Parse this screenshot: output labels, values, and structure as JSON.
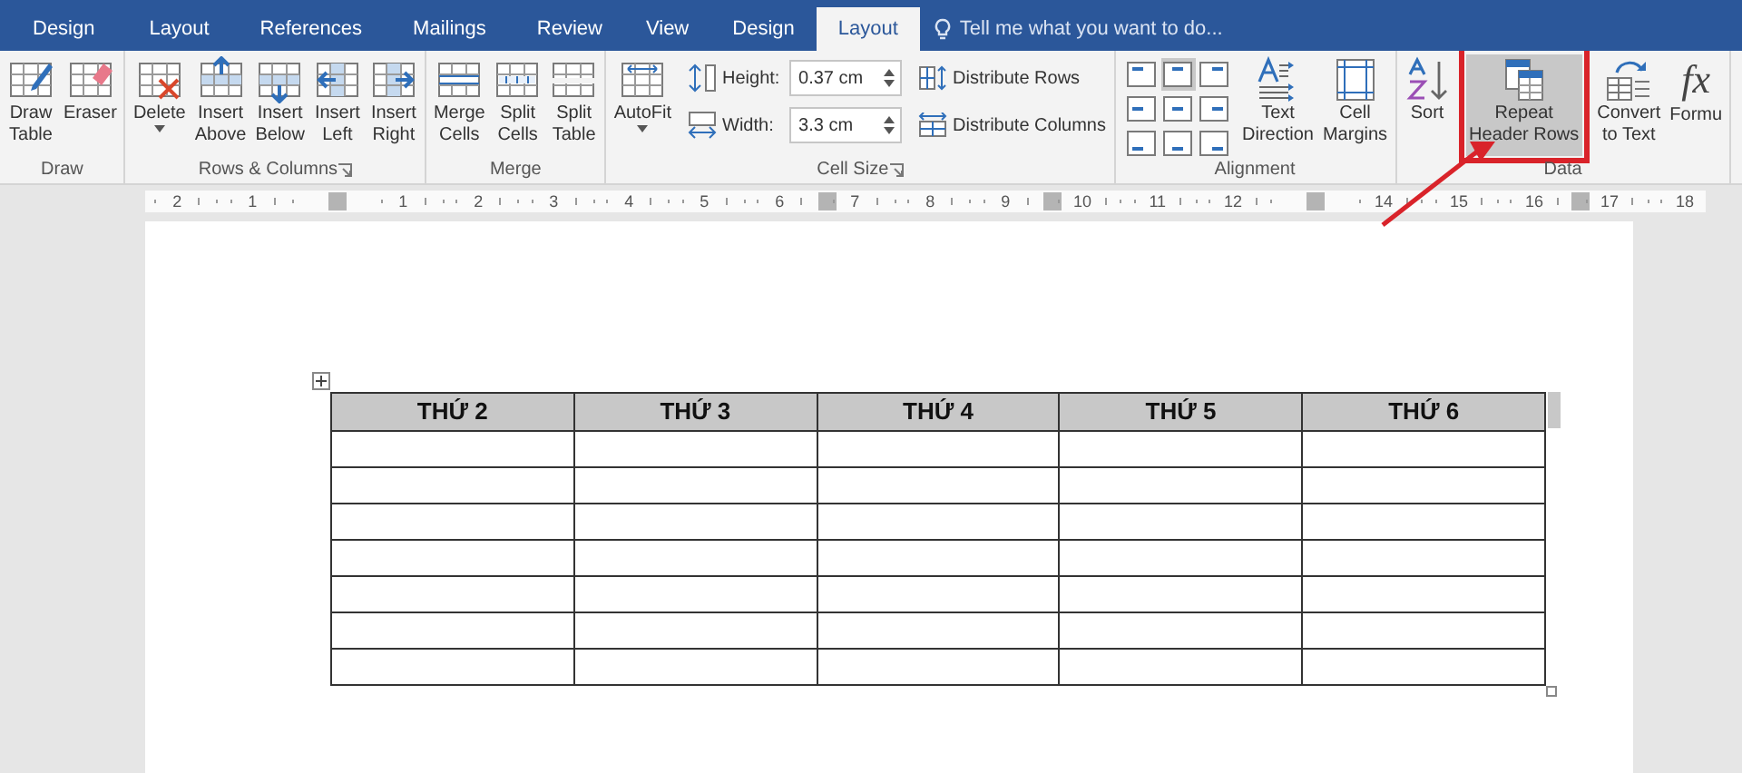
{
  "tabs": [
    {
      "label": "Design",
      "selected": false
    },
    {
      "label": "Layout",
      "selected": false
    },
    {
      "label": "References",
      "selected": false
    },
    {
      "label": "Mailings",
      "selected": false
    },
    {
      "label": "Review",
      "selected": false
    },
    {
      "label": "View",
      "selected": false
    },
    {
      "label": "Design",
      "selected": false
    },
    {
      "label": "Layout",
      "selected": true
    }
  ],
  "tell_me": {
    "placeholder": "Tell me what you want to do..."
  },
  "ribbon_groups": [
    {
      "label": "Draw",
      "launcher": false,
      "items": [
        {
          "kind": "large",
          "lines": [
            "Draw",
            "Table"
          ],
          "dropdown": false,
          "selected": false
        },
        {
          "kind": "large",
          "lines": [
            "Eraser"
          ],
          "dropdown": false,
          "selected": false
        }
      ]
    },
    {
      "label": "Rows & Columns",
      "launcher": true,
      "items": [
        {
          "kind": "large",
          "lines": [
            "Delete"
          ],
          "dropdown": true,
          "selected": false
        },
        {
          "kind": "large",
          "lines": [
            "Insert",
            "Above"
          ],
          "dropdown": false,
          "selected": false
        },
        {
          "kind": "large",
          "lines": [
            "Insert",
            "Below"
          ],
          "dropdown": false,
          "selected": false
        },
        {
          "kind": "large",
          "lines": [
            "Insert",
            "Left"
          ],
          "dropdown": false,
          "selected": false
        },
        {
          "kind": "large",
          "lines": [
            "Insert",
            "Right"
          ],
          "dropdown": false,
          "selected": false
        }
      ]
    },
    {
      "label": "Merge",
      "launcher": false,
      "items": [
        {
          "kind": "large",
          "lines": [
            "Merge",
            "Cells"
          ],
          "dropdown": false,
          "selected": false
        },
        {
          "kind": "large",
          "lines": [
            "Split",
            "Cells"
          ],
          "dropdown": false,
          "selected": false
        },
        {
          "kind": "large",
          "lines": [
            "Split",
            "Table"
          ],
          "dropdown": false,
          "selected": false
        }
      ]
    },
    {
      "label": "Cell Size",
      "launcher": true,
      "items": [
        {
          "kind": "large",
          "lines": [
            "AutoFit"
          ],
          "dropdown": true,
          "selected": false
        },
        {
          "kind": "spinners",
          "fields": [
            {
              "label": "Height:",
              "value": "0.37 cm"
            },
            {
              "label": "Width:",
              "value": "3.3 cm"
            }
          ]
        },
        {
          "kind": "small_stack",
          "buttons": [
            {
              "label": "Distribute Rows"
            },
            {
              "label": "Distribute Columns"
            }
          ]
        }
      ]
    },
    {
      "label": "Alignment",
      "launcher": false,
      "items": [
        {
          "kind": "align_grid",
          "cells": [
            {
              "selected": false
            },
            {
              "selected": true
            },
            {
              "selected": false
            },
            {
              "selected": false
            },
            {
              "selected": false
            },
            {
              "selected": false
            },
            {
              "selected": false
            },
            {
              "selected": false
            },
            {
              "selected": false
            }
          ]
        },
        {
          "kind": "large",
          "lines": [
            "Text",
            "Direction"
          ],
          "dropdown": false,
          "selected": false
        },
        {
          "kind": "large",
          "lines": [
            "Cell",
            "Margins"
          ],
          "dropdown": false,
          "selected": false
        }
      ]
    },
    {
      "label": "Data",
      "launcher": false,
      "items": [
        {
          "kind": "large",
          "lines": [
            "Sort"
          ],
          "dropdown": false,
          "selected": false
        },
        {
          "kind": "large",
          "lines": [
            "Repeat",
            "Header Rows"
          ],
          "dropdown": false,
          "selected": true
        },
        {
          "kind": "large",
          "lines": [
            "Convert",
            "to Text"
          ],
          "dropdown": false,
          "selected": false
        },
        {
          "kind": "large",
          "lines": [
            "Formu"
          ],
          "dropdown": false,
          "selected": false,
          "icon_text": "fx"
        }
      ]
    }
  ],
  "ruler": {
    "marks": [
      {
        "kind": "number",
        "label": "2"
      },
      {
        "kind": "number",
        "label": "1"
      },
      {
        "kind": "marker_slot"
      },
      {
        "kind": "number",
        "label": "1"
      },
      {
        "kind": "number",
        "label": "2"
      },
      {
        "kind": "number",
        "label": "3"
      },
      {
        "kind": "number",
        "label": "4"
      },
      {
        "kind": "number",
        "label": "5"
      },
      {
        "kind": "number",
        "label": "6"
      },
      {
        "kind": "marker"
      },
      {
        "kind": "number",
        "label": "7"
      },
      {
        "kind": "number",
        "label": "8"
      },
      {
        "kind": "number",
        "label": "9"
      },
      {
        "kind": "marker"
      },
      {
        "kind": "number",
        "label": "10"
      },
      {
        "kind": "number",
        "label": "11"
      },
      {
        "kind": "number",
        "label": "12"
      },
      {
        "kind": "marker_slot"
      },
      {
        "kind": "number",
        "label": "14"
      },
      {
        "kind": "number",
        "label": "15"
      },
      {
        "kind": "number",
        "label": "16"
      },
      {
        "kind": "marker"
      },
      {
        "kind": "number",
        "label": "17"
      },
      {
        "kind": "number",
        "label": "18"
      }
    ]
  },
  "table": {
    "header_selected": true,
    "columns": [
      "THỨ 2",
      "THỨ 3",
      "THỨ 4",
      "THỨ 5",
      "THỨ 6"
    ],
    "rows": [
      {
        "kind": "empty"
      },
      {
        "kind": "empty"
      },
      {
        "kind": "empty"
      },
      {
        "kind": "empty"
      },
      {
        "kind": "empty"
      },
      {
        "kind": "empty"
      },
      {
        "kind": "empty"
      }
    ]
  },
  "annotation": {
    "highlight_box": true,
    "arrow": true
  }
}
